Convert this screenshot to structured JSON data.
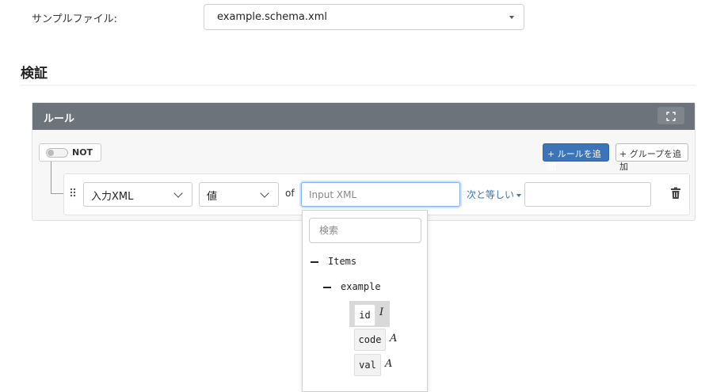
{
  "sample_file": {
    "label": "サンプルファイル:",
    "selected": "example.schema.xml"
  },
  "section": {
    "title": "検証"
  },
  "rules_panel": {
    "title": "ルール",
    "not_label": "NOT",
    "not_enabled": false,
    "add_rule_label": "+ ルールを追加",
    "add_group_label": "+ グループを追加"
  },
  "rule": {
    "field_select": "入力XML",
    "value_select": "値",
    "of_label": "of",
    "input_placeholder": "Input XML",
    "operator": "次と等しい",
    "value": ""
  },
  "dropdown": {
    "search_placeholder": "検索",
    "tree": {
      "root": "Items",
      "child": "example",
      "leaves": [
        {
          "name": "id",
          "type_glyph": "I",
          "selected": true
        },
        {
          "name": "code",
          "type_glyph": "A",
          "selected": false
        },
        {
          "name": "val",
          "type_glyph": "A",
          "selected": false
        }
      ]
    }
  },
  "colors": {
    "panel_header": "#6c737b",
    "primary_button": "#3c74b9",
    "link": "#3a73b7"
  }
}
